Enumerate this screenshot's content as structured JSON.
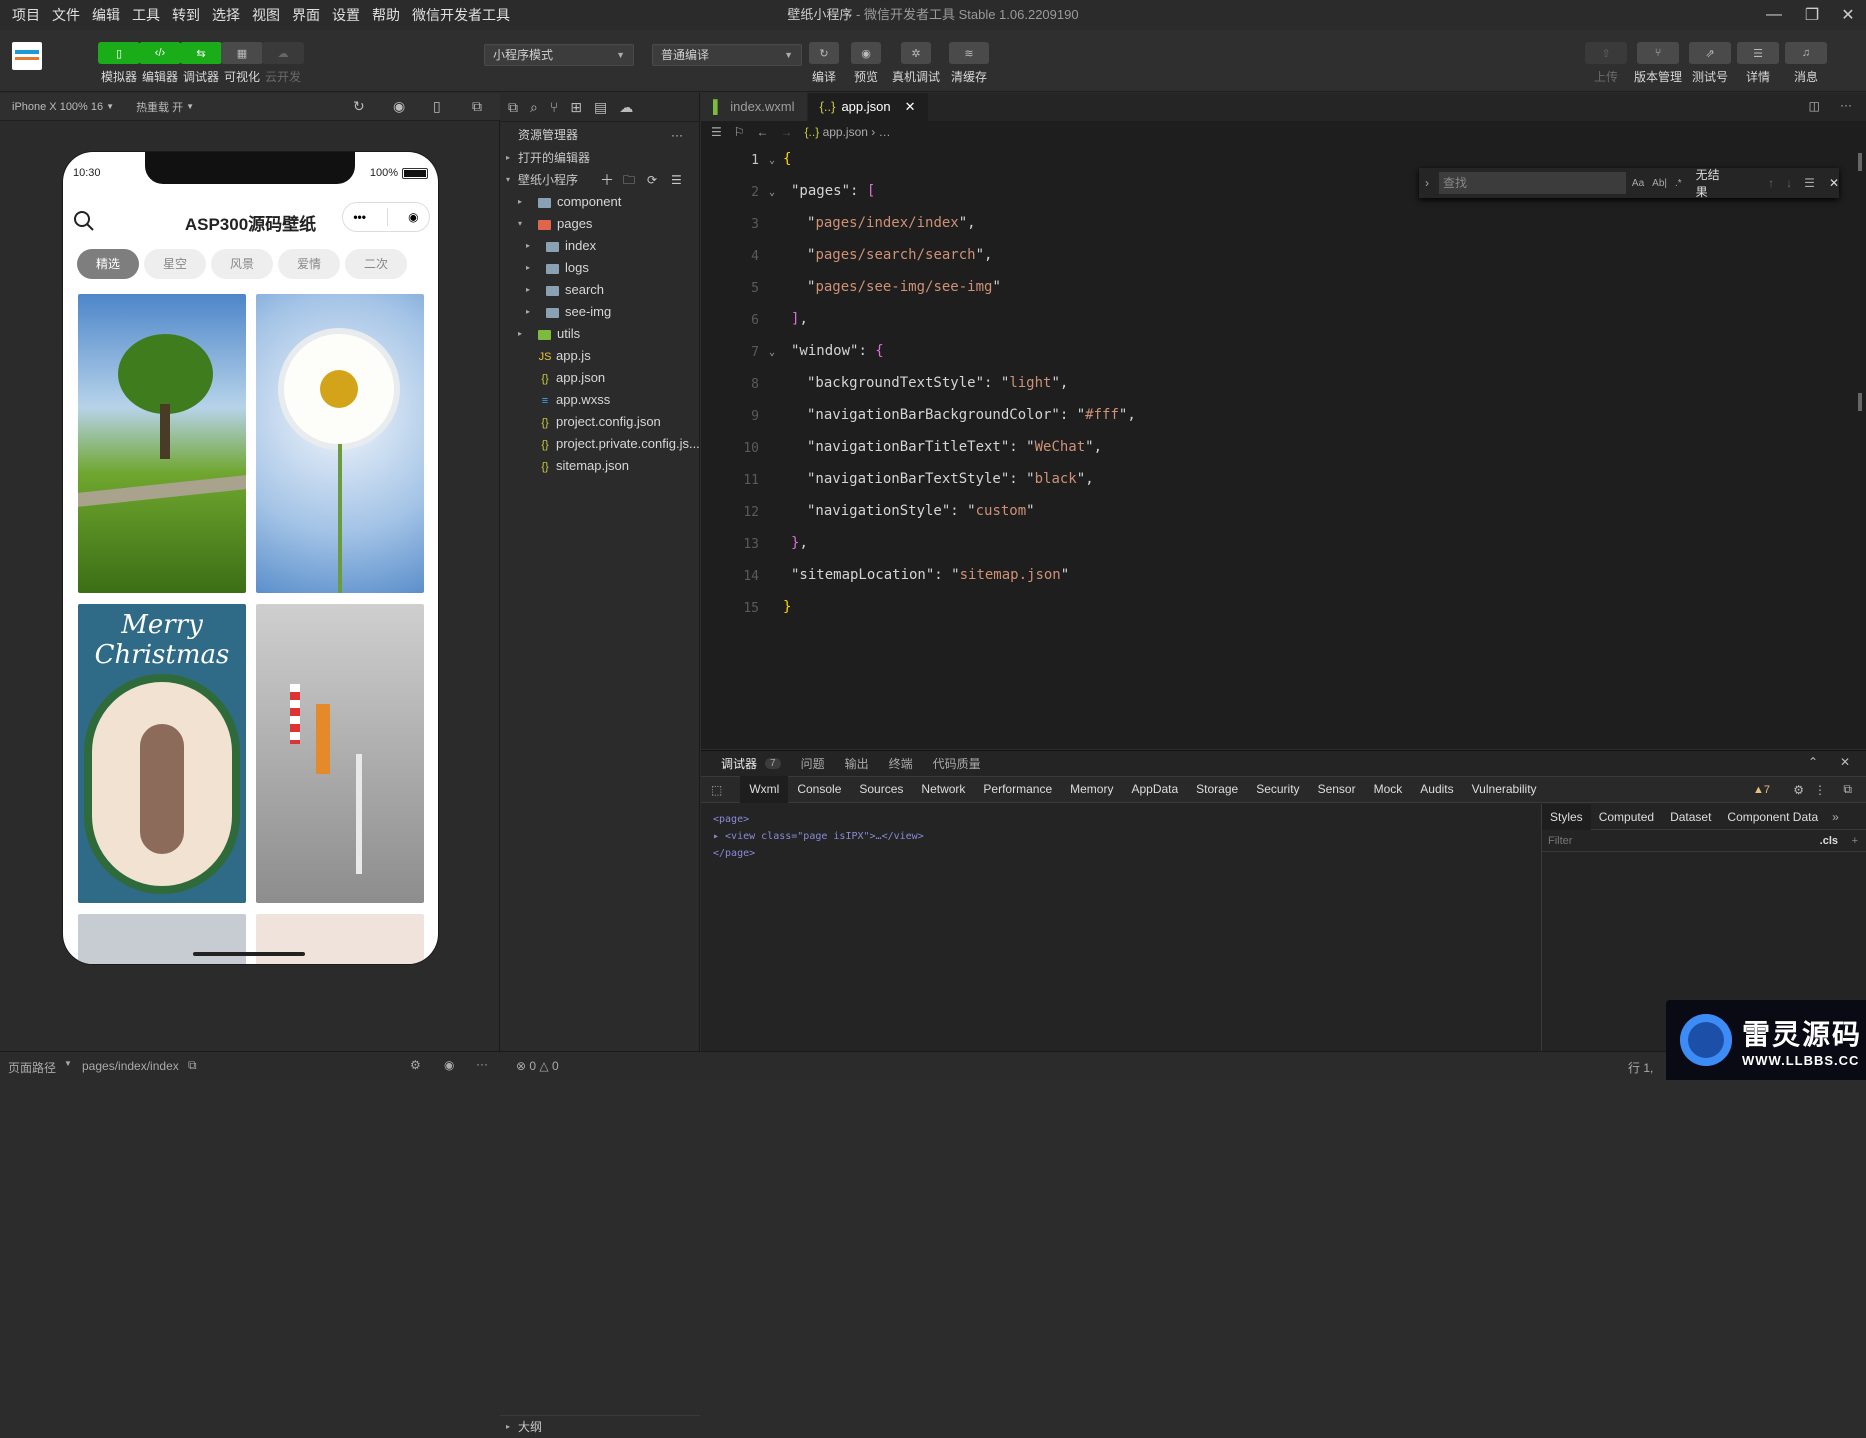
{
  "menu": [
    "项目",
    "文件",
    "编辑",
    "工具",
    "转到",
    "选择",
    "视图",
    "界面",
    "设置",
    "帮助",
    "微信开发者工具"
  ],
  "window": {
    "title": "壁纸小程序",
    "subtitle": "- 微信开发者工具 Stable 1.06.2209190"
  },
  "toolbar": {
    "left": [
      {
        "label": "模拟器",
        "icon": "phone-icon"
      },
      {
        "label": "编辑器",
        "icon": "code-icon"
      },
      {
        "label": "调试器",
        "icon": "debug-icon"
      },
      {
        "label": "可视化",
        "icon": "layout-icon"
      },
      {
        "label": "云开发",
        "icon": "cloud-icon"
      }
    ],
    "mode": "小程序模式",
    "compile": "普通编译",
    "middle": [
      {
        "label": "编译",
        "icon": "refresh-icon"
      },
      {
        "label": "预览",
        "icon": "eye-icon"
      },
      {
        "label": "真机调试",
        "icon": "bug-icon"
      },
      {
        "label": "清缓存",
        "icon": "layers-icon"
      }
    ],
    "right": [
      {
        "label": "上传",
        "icon": "upload-icon"
      },
      {
        "label": "版本管理",
        "icon": "branch-icon"
      },
      {
        "label": "测试号",
        "icon": "share-icon"
      },
      {
        "label": "详情",
        "icon": "menu-icon"
      },
      {
        "label": "消息",
        "icon": "bell-icon"
      }
    ]
  },
  "simbar": {
    "device": "iPhone X 100% 16",
    "hotreload": "热重载 开"
  },
  "phone": {
    "time": "10:30",
    "battery": "100%",
    "title": "ASP300源码壁纸",
    "categories": [
      "精选",
      "星空",
      "风景",
      "爱情",
      "二次"
    ]
  },
  "explorer": {
    "title": "资源管理器",
    "open_editors": "打开的编辑器",
    "project": "壁纸小程序",
    "tree": [
      {
        "name": "component",
        "depth": 1,
        "type": "folder",
        "arrow": "▸"
      },
      {
        "name": "pages",
        "depth": 1,
        "type": "folder-open",
        "arrow": "▾"
      },
      {
        "name": "index",
        "depth": 2,
        "type": "folder",
        "arrow": "▸"
      },
      {
        "name": "logs",
        "depth": 2,
        "type": "folder",
        "arrow": "▸"
      },
      {
        "name": "search",
        "depth": 2,
        "type": "folder",
        "arrow": "▸"
      },
      {
        "name": "see-img",
        "depth": 2,
        "type": "folder",
        "arrow": "▸"
      },
      {
        "name": "utils",
        "depth": 1,
        "type": "folder",
        "arrow": "▸"
      },
      {
        "name": "app.js",
        "depth": 1,
        "type": "js"
      },
      {
        "name": "app.json",
        "depth": 1,
        "type": "json"
      },
      {
        "name": "app.wxss",
        "depth": 1,
        "type": "css"
      },
      {
        "name": "project.config.json",
        "depth": 1,
        "type": "json"
      },
      {
        "name": "project.private.config.js...",
        "depth": 1,
        "type": "json"
      },
      {
        "name": "sitemap.json",
        "depth": 1,
        "type": "json"
      }
    ],
    "outline": "大纲"
  },
  "editor": {
    "tabs": [
      "index.wxml",
      "app.json"
    ],
    "breadcrumb": "app.json",
    "breadcrumb_more": "…",
    "find": {
      "placeholder": "查找",
      "result": "无结果"
    },
    "lines": [
      "1",
      "2",
      "3",
      "4",
      "5",
      "6",
      "7",
      "8",
      "9",
      "10",
      "11",
      "12",
      "13",
      "14",
      "15"
    ]
  },
  "devtools": {
    "top_tabs": [
      "调试器",
      "问题",
      "输出",
      "终端",
      "代码质量"
    ],
    "badge": "7",
    "tabs": [
      "Wxml",
      "Console",
      "Sources",
      "Network",
      "Performance",
      "Memory",
      "AppData",
      "Storage",
      "Security",
      "Sensor",
      "Mock",
      "Audits",
      "Vulnerability"
    ],
    "warn": "▲7",
    "wxml": [
      "<page>",
      "▸ <view class=\"page isIPX\">…</view>",
      "</page>"
    ],
    "styles_tabs": [
      "Styles",
      "Computed",
      "Dataset",
      "Component Data"
    ],
    "filter_placeholder": "Filter",
    "cls": ".cls"
  },
  "status": {
    "path_label": "页面路径",
    "path": "pages/index/index",
    "errors": "⊗ 0 △ 0",
    "cursor": "行 1,"
  },
  "watermark": {
    "title": "雷灵源码",
    "url": "WWW.LLBBS.CC"
  }
}
